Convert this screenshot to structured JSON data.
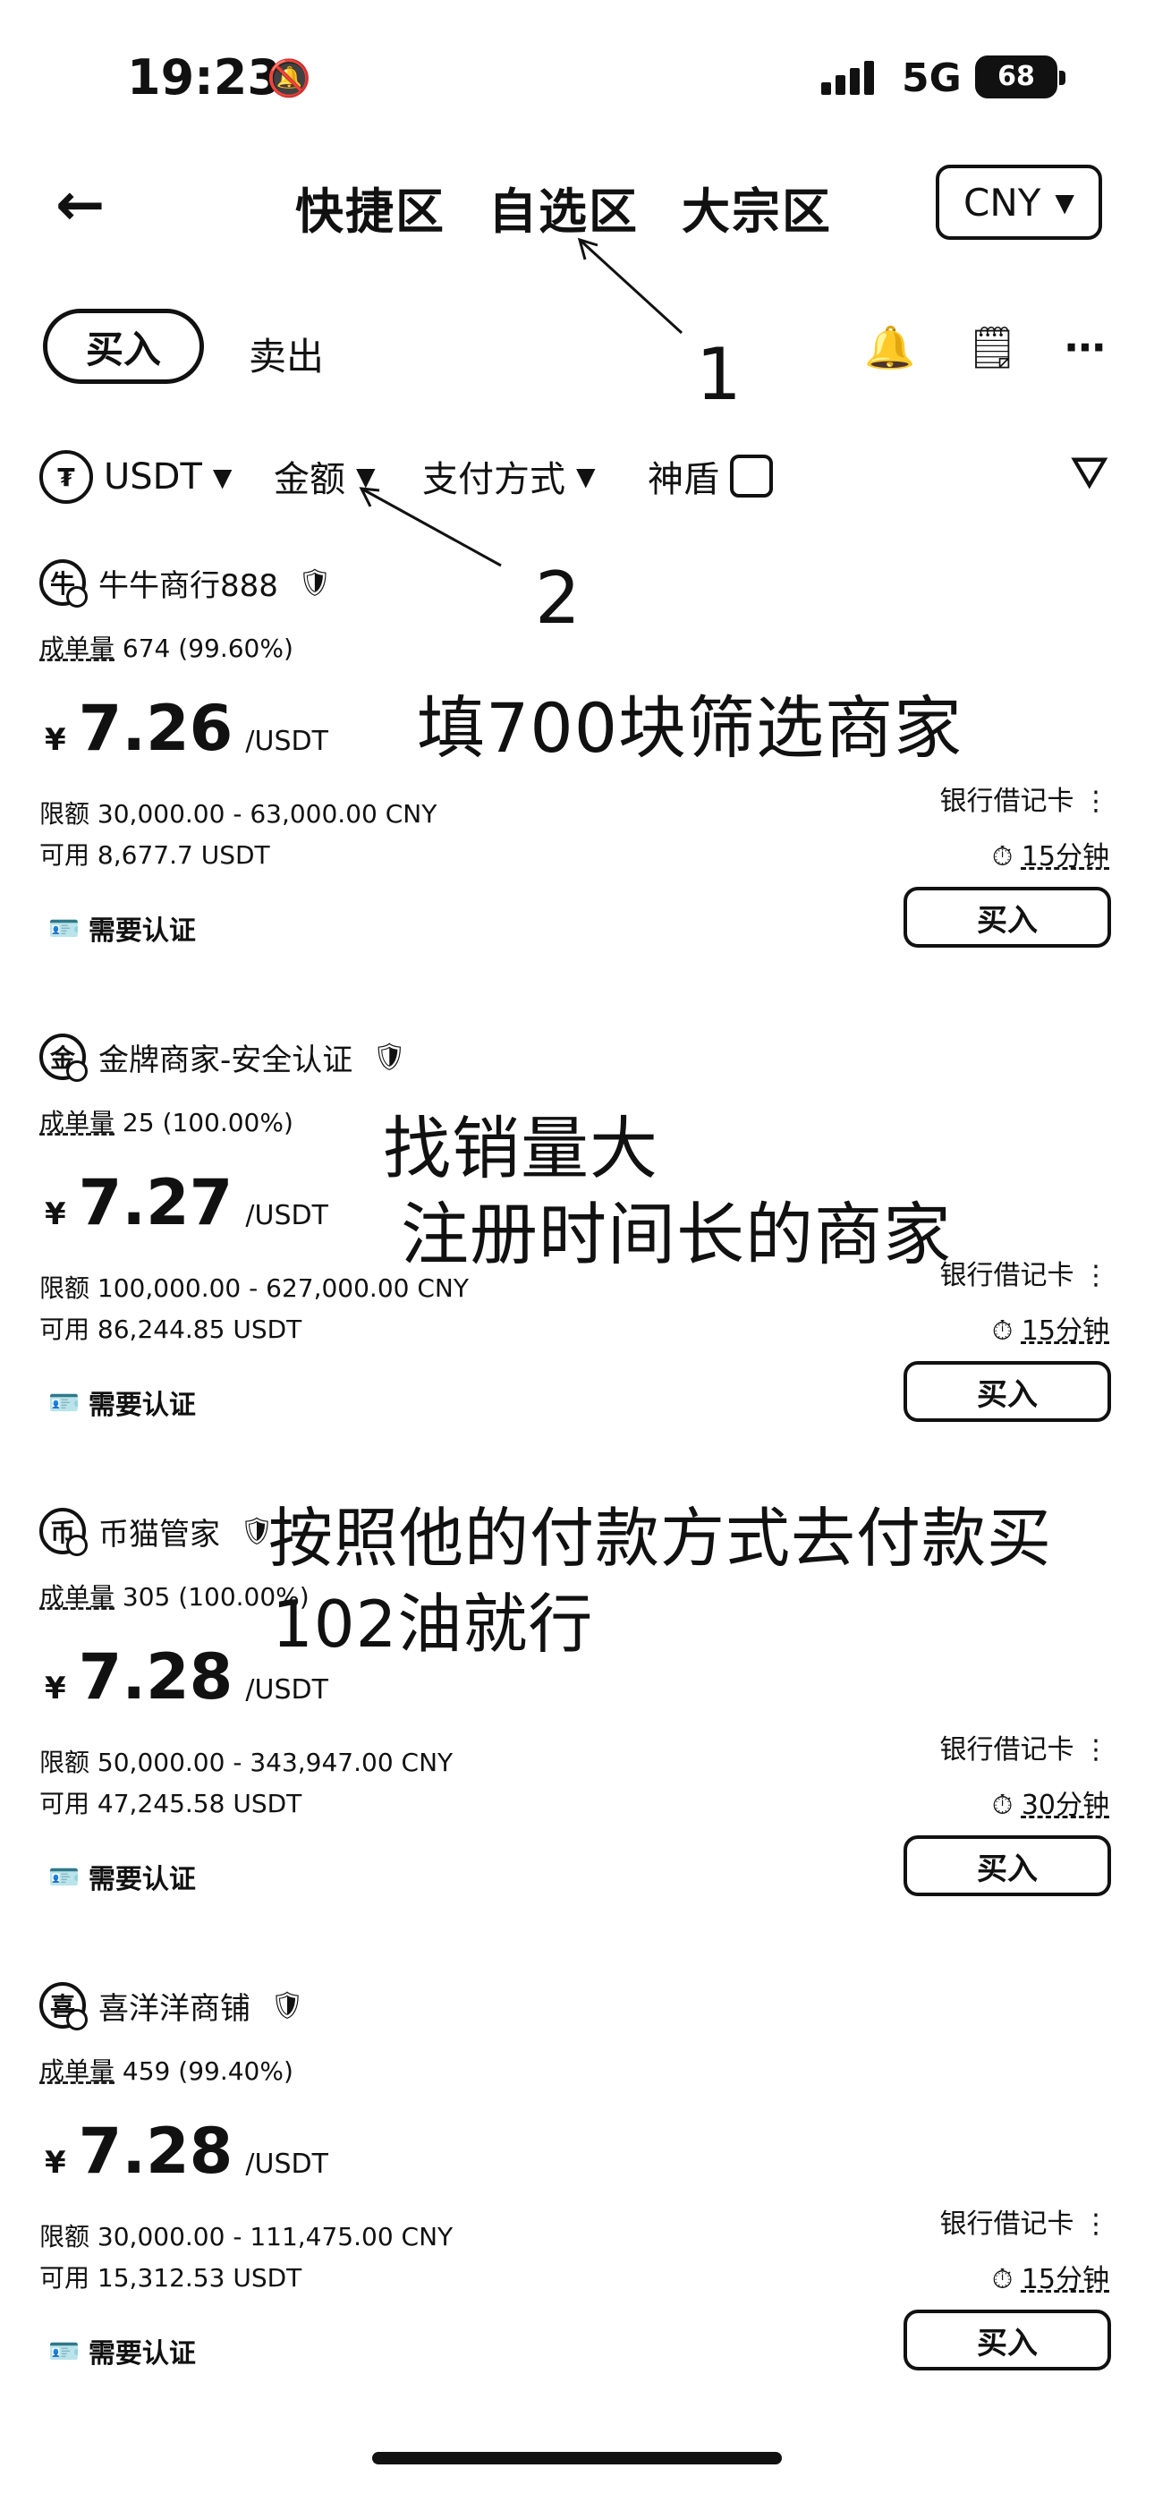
{
  "status": {
    "time": "19:23",
    "network": "5G",
    "battery": "68"
  },
  "nav": {
    "tabs": [
      "快捷区",
      "自选区",
      "大宗区"
    ],
    "currency": "CNY"
  },
  "trade": {
    "buy": "买入",
    "sell": "卖出"
  },
  "filters": {
    "coin": "USDT",
    "coin_symbol": "₮",
    "amount": "金额",
    "payment": "支付方式",
    "shield": "神盾"
  },
  "annotations": {
    "n1": "1",
    "n2": "2",
    "note1": "填700块筛选商家",
    "note2a": "找销量大",
    "note2b": "注册时间长的商家",
    "note3a": "按照他的付款方式去付款买",
    "note3b": "102油就行"
  },
  "merchants": [
    {
      "avatar": "牛",
      "name": "牛牛商行888",
      "stats_label": "成单量",
      "stats": "674 (99.60%)",
      "yen": "¥",
      "price": "7.26",
      "unit": "/USDT",
      "limit_label": "限额",
      "limit": "30,000.00 - 63,000.00 CNY",
      "avail_label": "可用",
      "avail": "8,677.7 USDT",
      "pay": "银行借记卡",
      "time": "15分钟",
      "verify": "需要认证",
      "buy": "买入"
    },
    {
      "avatar": "金",
      "name": "金牌商家-安全认证",
      "stats_label": "成单量",
      "stats": "25 (100.00%)",
      "yen": "¥",
      "price": "7.27",
      "unit": "/USDT",
      "limit_label": "限额",
      "limit": "100,000.00 - 627,000.00 CNY",
      "avail_label": "可用",
      "avail": "86,244.85 USDT",
      "pay": "银行借记卡",
      "time": "15分钟",
      "verify": "需要认证",
      "buy": "买入"
    },
    {
      "avatar": "币",
      "name": "币猫管家",
      "stats_label": "成单量",
      "stats": "305 (100.00%)",
      "yen": "¥",
      "price": "7.28",
      "unit": "/USDT",
      "limit_label": "限额",
      "limit": "50,000.00 - 343,947.00 CNY",
      "avail_label": "可用",
      "avail": "47,245.58 USDT",
      "pay": "银行借记卡",
      "time": "30分钟",
      "verify": "需要认证",
      "buy": "买入"
    },
    {
      "avatar": "喜",
      "name": "喜洋洋商铺",
      "stats_label": "成单量",
      "stats": "459 (99.40%)",
      "yen": "¥",
      "price": "7.28",
      "unit": "/USDT",
      "limit_label": "限额",
      "limit": "30,000.00 - 111,475.00 CNY",
      "avail_label": "可用",
      "avail": "15,312.53 USDT",
      "pay": "银行借记卡",
      "time": "15分钟",
      "verify": "需要认证",
      "buy": "买入"
    }
  ]
}
